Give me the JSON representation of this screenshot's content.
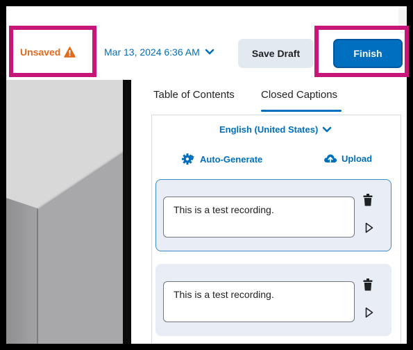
{
  "toolbar": {
    "unsaved_label": "Unsaved",
    "date_label": "Mar 13, 2024 6:36 AM",
    "save_draft_label": "Save Draft",
    "finish_label": "Finish"
  },
  "tabs": [
    {
      "label": "Table of Contents",
      "active": false
    },
    {
      "label": "Closed Captions",
      "active": true
    }
  ],
  "captions_panel": {
    "language": "English (United States)",
    "auto_generate_label": "Auto-Generate",
    "upload_label": "Upload",
    "captions": [
      {
        "text": "This is a test recording.",
        "selected": true
      },
      {
        "text": "This is a test recording.",
        "selected": false
      }
    ]
  },
  "colors": {
    "accent": "#006fbf",
    "warning": "#e16a1c",
    "highlight_border": "#c8157a"
  },
  "icons": [
    "warning-icon",
    "chevron-down-icon",
    "gear-icon",
    "upload-cloud-icon",
    "trash-icon",
    "play-icon"
  ]
}
